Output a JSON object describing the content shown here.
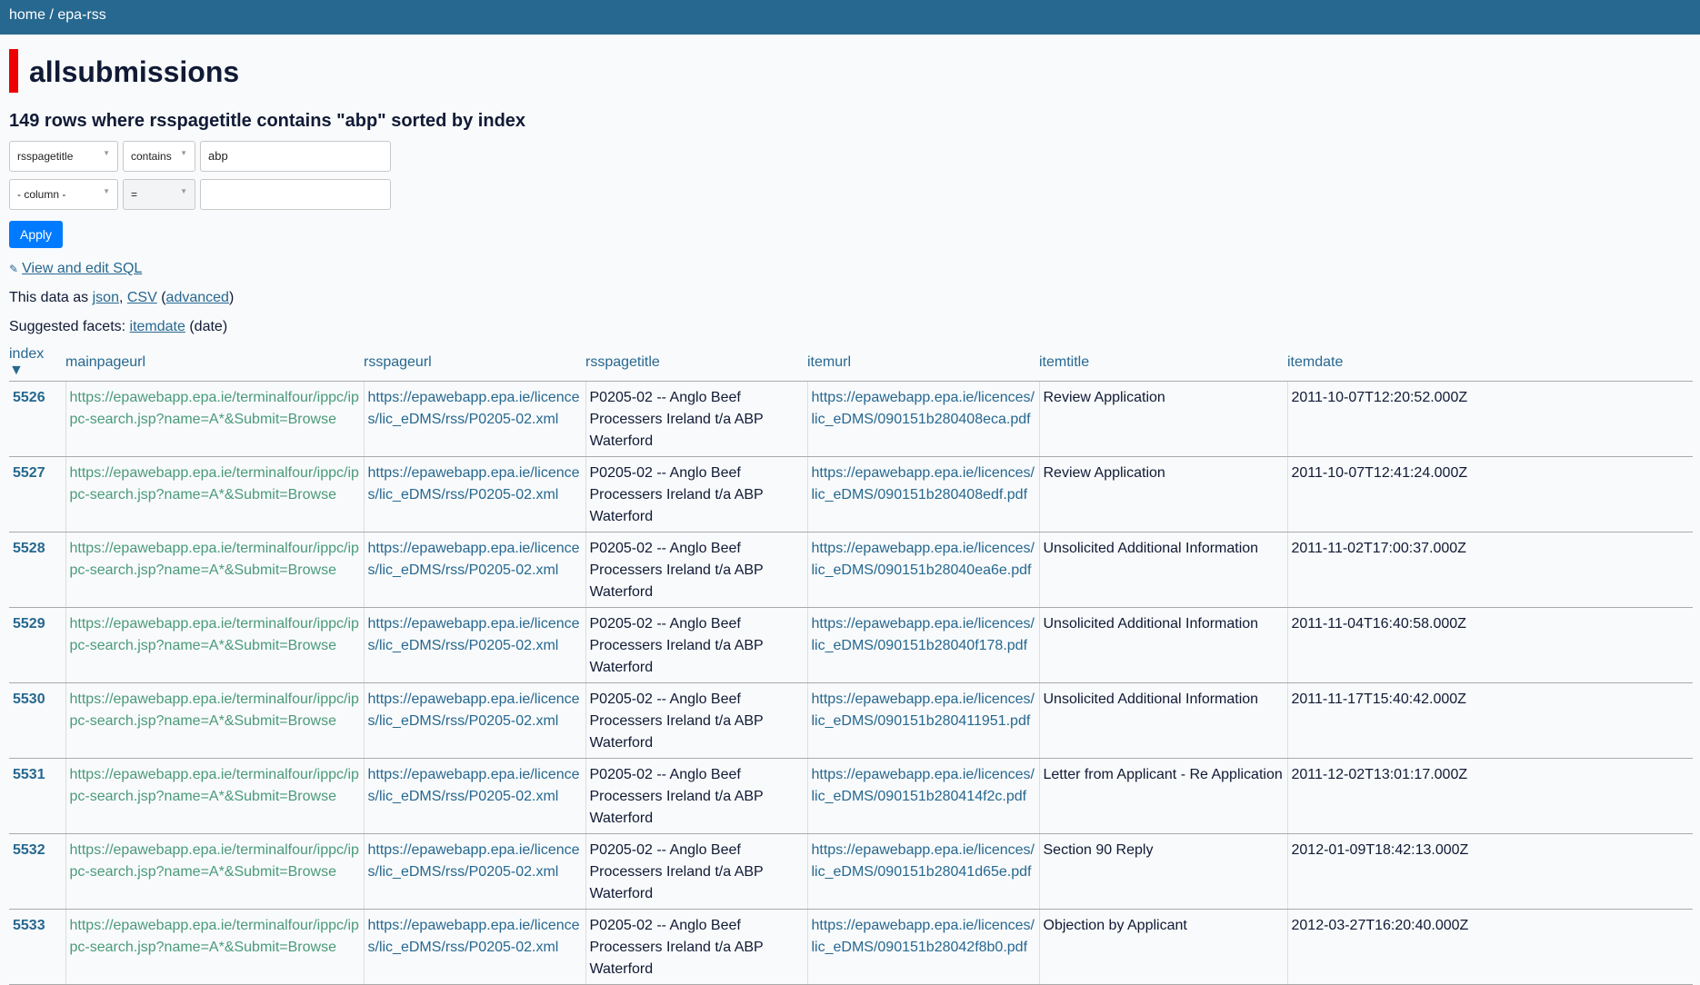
{
  "breadcrumb": {
    "home": "home",
    "sep": " / ",
    "db": "epa-rss"
  },
  "page_title": "allsubmissions",
  "summary": "149 rows where rsspagetitle contains \"abp\" sorted by index",
  "filters": [
    {
      "column": "rsspagetitle",
      "op": "contains",
      "value": "abp"
    },
    {
      "column": "- column -",
      "op": "=",
      "value": ""
    }
  ],
  "apply_label": "Apply",
  "sql_link": "View and edit SQL",
  "export": {
    "prefix": "This data as ",
    "json": "json",
    "comma": ", ",
    "csv": "CSV",
    "open": " (",
    "advanced": "advanced",
    "close": ")"
  },
  "facets": {
    "prefix": "Suggested facets: ",
    "itemdate": "itemdate",
    "suffix": " (date)"
  },
  "columns": [
    "index ▼",
    "mainpageurl",
    "rsspageurl",
    "rsspagetitle",
    "itemurl",
    "itemtitle",
    "itemdate"
  ],
  "rows": [
    {
      "index": "5526",
      "mainpageurl": "https://epawebapp.epa.ie/terminalfour/ippc/ippc-search.jsp?name=A*&Submit=Browse",
      "rsspageurl": "https://epawebapp.epa.ie/licences/lic_eDMS/rss/P0205-02.xml",
      "rsspagetitle": "P0205-02 -- Anglo Beef Processers Ireland t/a ABP Waterford",
      "itemurl": "https://epawebapp.epa.ie/licences/lic_eDMS/090151b280408eca.pdf",
      "itemtitle": "Review Application",
      "itemdate": "2011-10-07T12:20:52.000Z"
    },
    {
      "index": "5527",
      "mainpageurl": "https://epawebapp.epa.ie/terminalfour/ippc/ippc-search.jsp?name=A*&Submit=Browse",
      "rsspageurl": "https://epawebapp.epa.ie/licences/lic_eDMS/rss/P0205-02.xml",
      "rsspagetitle": "P0205-02 -- Anglo Beef Processers Ireland t/a ABP Waterford",
      "itemurl": "https://epawebapp.epa.ie/licences/lic_eDMS/090151b280408edf.pdf",
      "itemtitle": "Review Application",
      "itemdate": "2011-10-07T12:41:24.000Z"
    },
    {
      "index": "5528",
      "mainpageurl": "https://epawebapp.epa.ie/terminalfour/ippc/ippc-search.jsp?name=A*&Submit=Browse",
      "rsspageurl": "https://epawebapp.epa.ie/licences/lic_eDMS/rss/P0205-02.xml",
      "rsspagetitle": "P0205-02 -- Anglo Beef Processers Ireland t/a ABP Waterford",
      "itemurl": "https://epawebapp.epa.ie/licences/lic_eDMS/090151b28040ea6e.pdf",
      "itemtitle": "Unsolicited Additional Information",
      "itemdate": "2011-11-02T17:00:37.000Z"
    },
    {
      "index": "5529",
      "mainpageurl": "https://epawebapp.epa.ie/terminalfour/ippc/ippc-search.jsp?name=A*&Submit=Browse",
      "rsspageurl": "https://epawebapp.epa.ie/licences/lic_eDMS/rss/P0205-02.xml",
      "rsspagetitle": "P0205-02 -- Anglo Beef Processers Ireland t/a ABP Waterford",
      "itemurl": "https://epawebapp.epa.ie/licences/lic_eDMS/090151b28040f178.pdf",
      "itemtitle": "Unsolicited Additional Information",
      "itemdate": "2011-11-04T16:40:58.000Z"
    },
    {
      "index": "5530",
      "mainpageurl": "https://epawebapp.epa.ie/terminalfour/ippc/ippc-search.jsp?name=A*&Submit=Browse",
      "rsspageurl": "https://epawebapp.epa.ie/licences/lic_eDMS/rss/P0205-02.xml",
      "rsspagetitle": "P0205-02 -- Anglo Beef Processers Ireland t/a ABP Waterford",
      "itemurl": "https://epawebapp.epa.ie/licences/lic_eDMS/090151b280411951.pdf",
      "itemtitle": "Unsolicited Additional Information",
      "itemdate": "2011-11-17T15:40:42.000Z"
    },
    {
      "index": "5531",
      "mainpageurl": "https://epawebapp.epa.ie/terminalfour/ippc/ippc-search.jsp?name=A*&Submit=Browse",
      "rsspageurl": "https://epawebapp.epa.ie/licences/lic_eDMS/rss/P0205-02.xml",
      "rsspagetitle": "P0205-02 -- Anglo Beef Processers Ireland t/a ABP Waterford",
      "itemurl": "https://epawebapp.epa.ie/licences/lic_eDMS/090151b280414f2c.pdf",
      "itemtitle": "Letter from Applicant - Re Application",
      "itemdate": "2011-12-02T13:01:17.000Z"
    },
    {
      "index": "5532",
      "mainpageurl": "https://epawebapp.epa.ie/terminalfour/ippc/ippc-search.jsp?name=A*&Submit=Browse",
      "rsspageurl": "https://epawebapp.epa.ie/licences/lic_eDMS/rss/P0205-02.xml",
      "rsspagetitle": "P0205-02 -- Anglo Beef Processers Ireland t/a ABP Waterford",
      "itemurl": "https://epawebapp.epa.ie/licences/lic_eDMS/090151b28041d65e.pdf",
      "itemtitle": "Section 90 Reply",
      "itemdate": "2012-01-09T18:42:13.000Z"
    },
    {
      "index": "5533",
      "mainpageurl": "https://epawebapp.epa.ie/terminalfour/ippc/ippc-search.jsp?name=A*&Submit=Browse",
      "rsspageurl": "https://epawebapp.epa.ie/licences/lic_eDMS/rss/P0205-02.xml",
      "rsspagetitle": "P0205-02 -- Anglo Beef Processers Ireland t/a ABP Waterford",
      "itemurl": "https://epawebapp.epa.ie/licences/lic_eDMS/090151b28042f8b0.pdf",
      "itemtitle": "Objection by Applicant",
      "itemdate": "2012-03-27T16:20:40.000Z"
    }
  ]
}
